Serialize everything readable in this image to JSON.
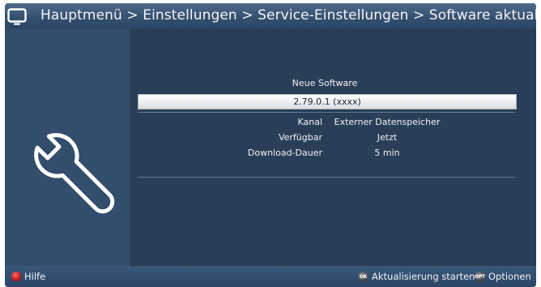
{
  "title": {
    "breadcrumb": "Hauptmenü > Einstellungen > Service-Einstellungen > Software aktualisieren",
    "icon": "tv-icon"
  },
  "side_panel": {
    "icon": "wrench-icon"
  },
  "main": {
    "section_title": "Neue Software",
    "selected_version": "2.79.0.1 (xxxx)",
    "details": [
      {
        "label": "Kanal",
        "value": "Externer Datenspeicher"
      },
      {
        "label": "Verfügbar",
        "value": "Jetzt"
      },
      {
        "label": "Download-Dauer",
        "value": "5 min"
      }
    ]
  },
  "footer": {
    "help_label": "Hilfe",
    "help_key_color": "#d21f1f",
    "ok_key": "OK",
    "ok_label": "Aktualisierung starten",
    "opt_key": "OPT",
    "opt_label": "Optionen"
  },
  "colors": {
    "background": "#2a3e57",
    "side_panel": "#334d6c",
    "selection": "#e6e9ec"
  }
}
